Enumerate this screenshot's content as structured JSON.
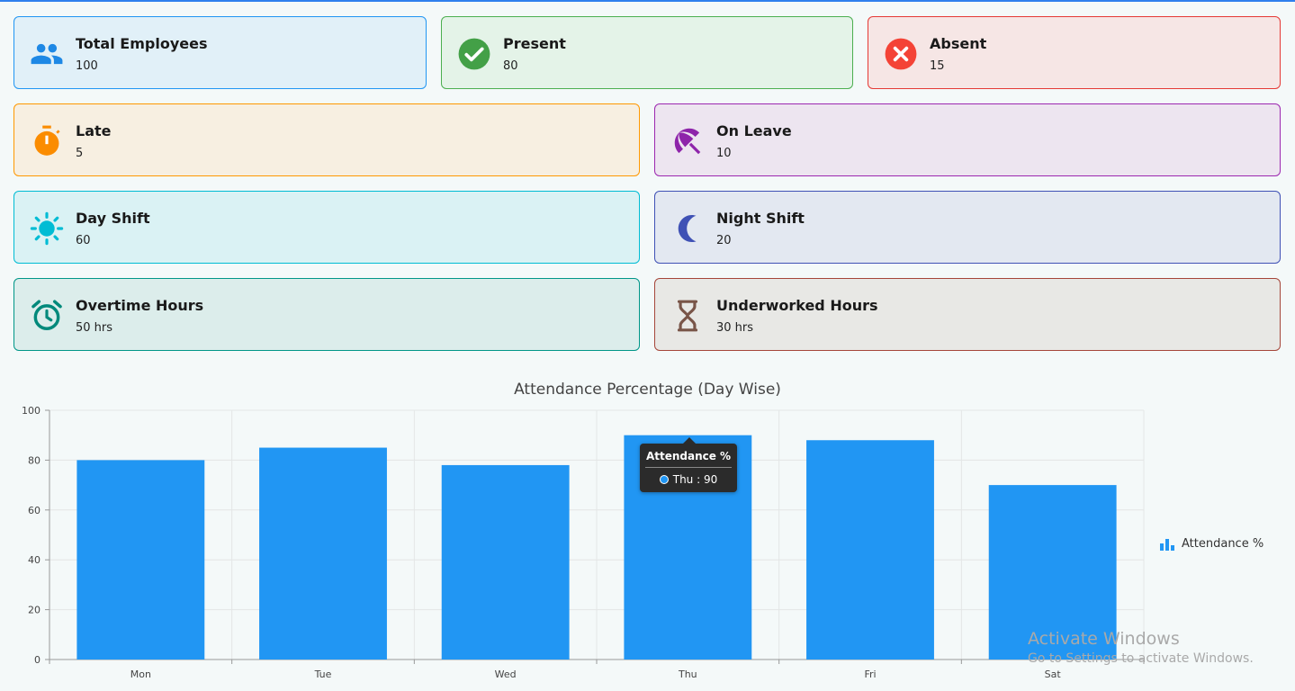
{
  "cards": [
    {
      "title": "Total Employees",
      "value": "100",
      "icon": "people-icon",
      "color": "#1e88e5",
      "bg": "#e1f0f8",
      "border": "#2196f3"
    },
    {
      "title": "Present",
      "value": "80",
      "icon": "check-circle-icon",
      "color": "#43a047",
      "bg": "#e4f3e8",
      "border": "#4caf50"
    },
    {
      "title": "Absent",
      "value": "15",
      "icon": "cancel-circle-icon",
      "color": "#f44336",
      "bg": "#f6e6e5",
      "border": "#e53935"
    },
    {
      "title": "Late",
      "value": "5",
      "icon": "stopwatch-icon",
      "color": "#fb8c00",
      "bg": "#f7efe1",
      "border": "#ff9800"
    },
    {
      "title": "On Leave",
      "value": "10",
      "icon": "beach-umbrella-icon",
      "color": "#8e24aa",
      "bg": "#ede5f0",
      "border": "#9c27b0"
    },
    {
      "title": "Day Shift",
      "value": "60",
      "icon": "sun-icon",
      "color": "#00bcd4",
      "bg": "#daf2f4",
      "border": "#00bcd4"
    },
    {
      "title": "Night Shift",
      "value": "20",
      "icon": "moon-icon",
      "color": "#3f51b5",
      "bg": "#e3e8f1",
      "border": "#3f51b5"
    },
    {
      "title": "Overtime Hours",
      "value": "50 hrs",
      "icon": "alarm-clock-icon",
      "color": "#00897b",
      "bg": "#dcedeb",
      "border": "#009688"
    },
    {
      "title": "Underworked Hours",
      "value": "30 hrs",
      "icon": "hourglass-icon",
      "color": "#795548",
      "bg": "#e8e8e5",
      "border": "#a5463a"
    }
  ],
  "chart_data": {
    "type": "bar",
    "title": "Attendance Percentage (Day Wise)",
    "categories": [
      "Mon",
      "Tue",
      "Wed",
      "Thu",
      "Fri",
      "Sat"
    ],
    "series": [
      {
        "name": "Attendance %",
        "values": [
          80,
          85,
          78,
          90,
          88,
          70
        ],
        "color": "#2196f3"
      }
    ],
    "ylim": [
      0,
      100
    ],
    "yticks": [
      "0",
      "20",
      "40",
      "60",
      "80",
      "100"
    ],
    "grid": true,
    "legend": "right"
  },
  "tooltip": {
    "title": "Attendance %",
    "row": "Thu : 90"
  },
  "watermark": {
    "line1": "Activate Windows",
    "line2": "Go to Settings to activate Windows."
  }
}
